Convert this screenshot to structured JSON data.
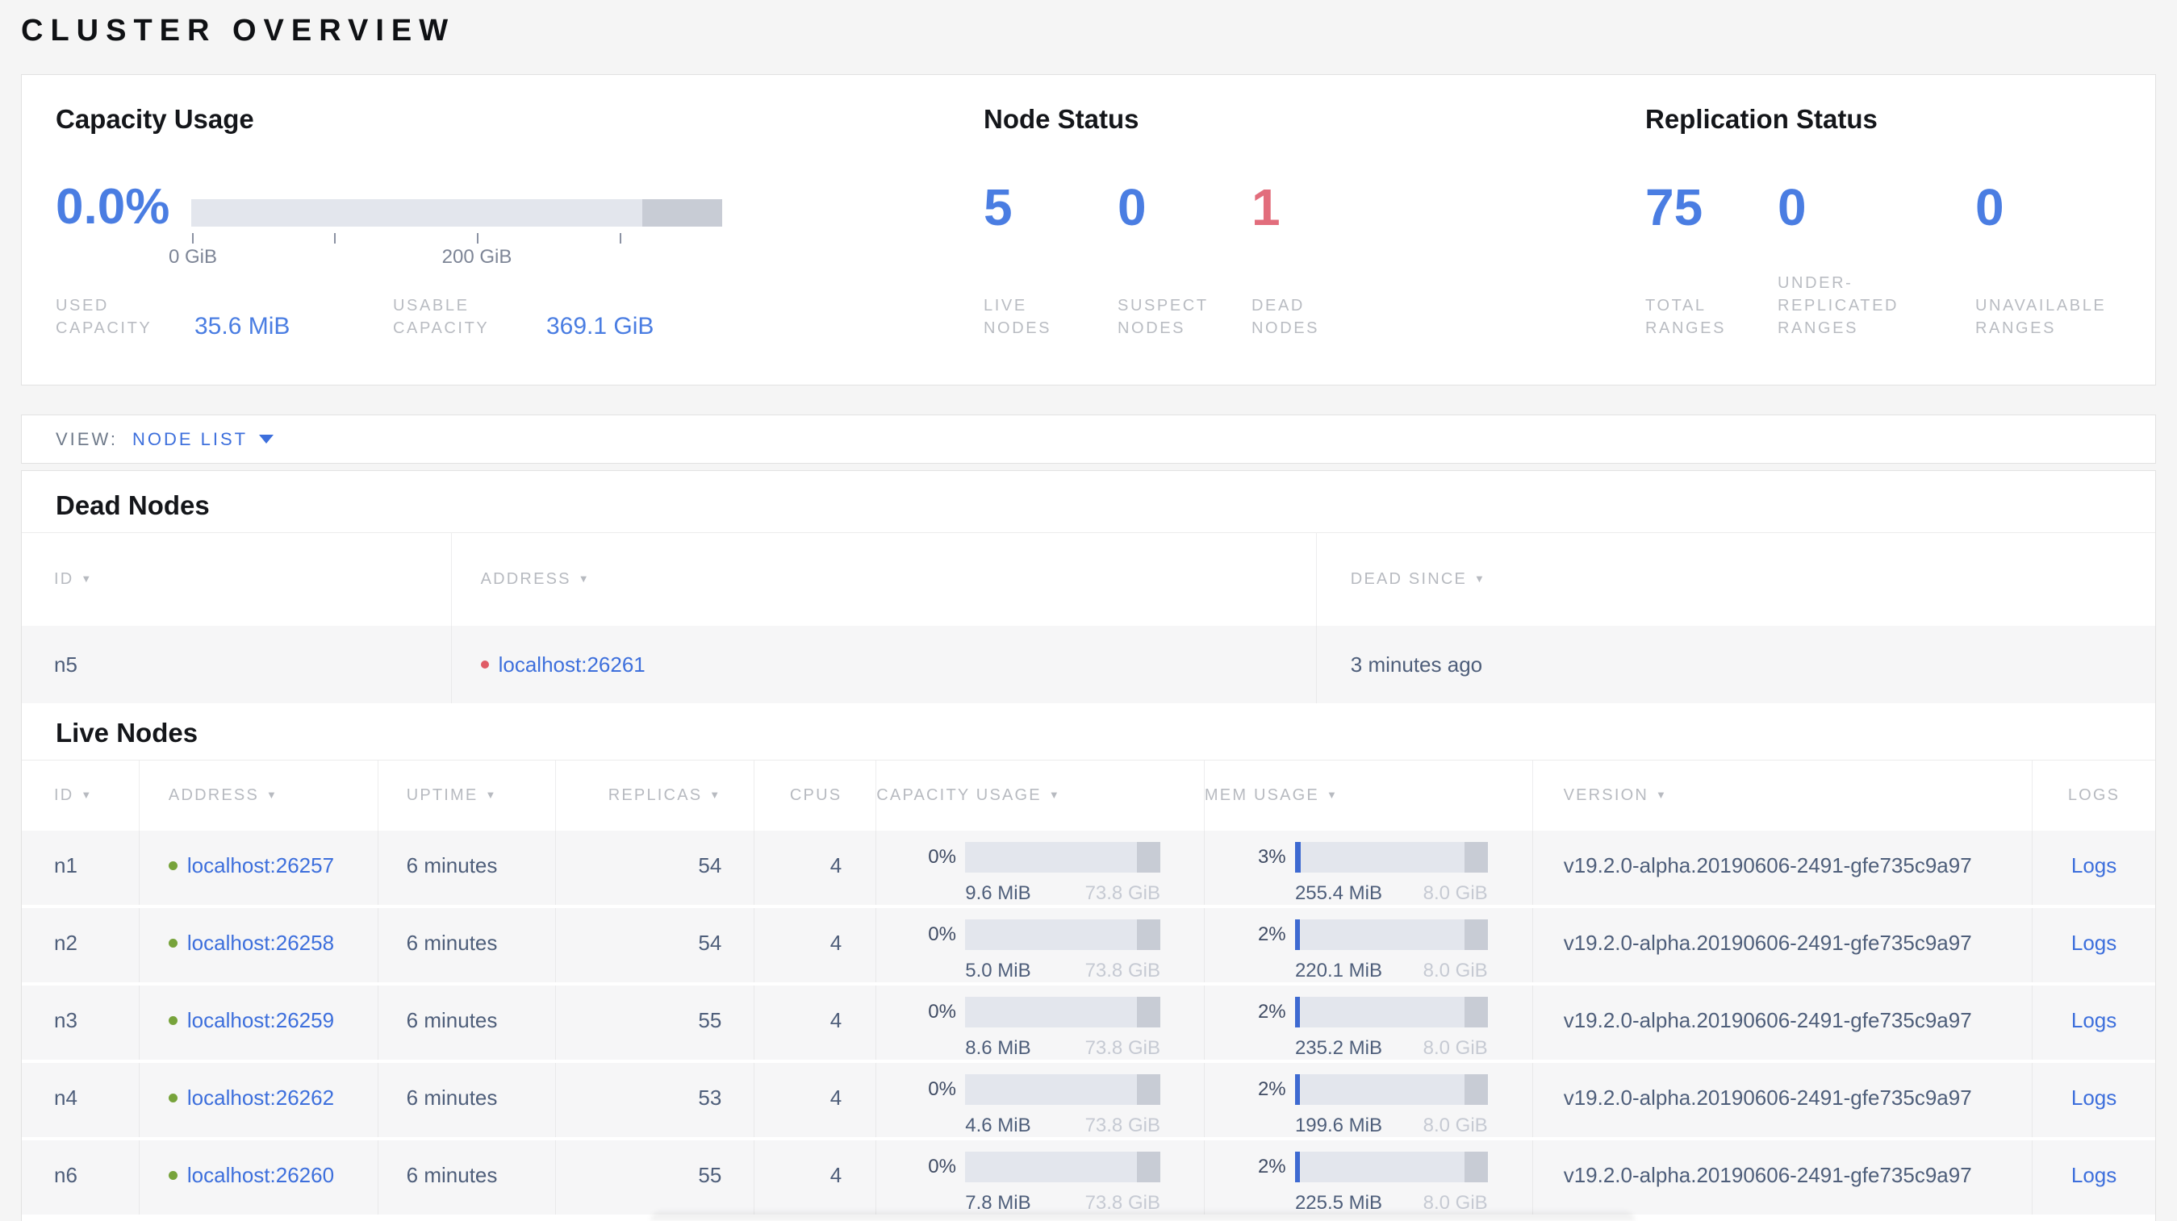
{
  "page": {
    "title": "CLUSTER OVERVIEW"
  },
  "colors": {
    "page_bg": "#f5f5f5",
    "card_border": "#e2e2e2",
    "accent_blue": "#4a7de2",
    "link_blue": "#3d6fdc",
    "dead_red": "#e26d7c",
    "dot_green": "#77a33b",
    "dot_red": "#e05c66",
    "label_gray": "#b9bcc2",
    "text_dark": "#16181d",
    "slate": "#4e5e7a",
    "bar_track": "#e3e6ed",
    "bar_dark": "#c8ccd5",
    "bar_blue": "#3e6ad1",
    "row_bg": "#f6f6f7"
  },
  "summary": {
    "capacity": {
      "title": "Capacity Usage",
      "percent": "0.0%",
      "tick_labels": [
        "0 GiB",
        "200 GiB"
      ],
      "stats": [
        {
          "label": "USED CAPACITY",
          "value": "35.6 MiB"
        },
        {
          "label": "USABLE CAPACITY",
          "value": "369.1 GiB"
        }
      ]
    },
    "node_status": {
      "title": "Node Status",
      "stats": [
        {
          "value": "5",
          "label": "LIVE NODES",
          "danger": false
        },
        {
          "value": "0",
          "label": "SUSPECT NODES",
          "danger": false
        },
        {
          "value": "1",
          "label": "DEAD NODES",
          "danger": true
        }
      ]
    },
    "replication": {
      "title": "Replication Status",
      "stats": [
        {
          "value": "75",
          "label": "TOTAL RANGES"
        },
        {
          "value": "0",
          "label": "UNDER-REPLICATED RANGES"
        },
        {
          "value": "0",
          "label": "UNAVAILABLE RANGES"
        }
      ]
    }
  },
  "view_bar": {
    "label": "VIEW:",
    "selected": "NODE LIST"
  },
  "dead_nodes": {
    "title": "Dead Nodes",
    "columns": [
      {
        "label": "ID",
        "sort_icon": true
      },
      {
        "label": "ADDRESS",
        "sort_icon": true
      },
      {
        "label": "DEAD SINCE",
        "sort_icon": true
      }
    ],
    "rows": [
      {
        "id": "n5",
        "address": "localhost:26261",
        "dead_since": "3 minutes ago"
      }
    ]
  },
  "live_nodes": {
    "title": "Live Nodes",
    "logs_label": "Logs",
    "columns": [
      {
        "label": "ID",
        "sort_icon": true
      },
      {
        "label": "ADDRESS",
        "sort_icon": true
      },
      {
        "label": "UPTIME",
        "sort_icon": true
      },
      {
        "label": "REPLICAS",
        "sort_icon": true
      },
      {
        "label": "CPUS",
        "sort_icon": false
      },
      {
        "label": "CAPACITY USAGE",
        "sort_icon": true
      },
      {
        "label": "MEM USAGE",
        "sort_icon": true
      },
      {
        "label": "VERSION",
        "sort_icon": true
      },
      {
        "label": "LOGS",
        "sort_icon": false
      }
    ],
    "rows": [
      {
        "id": "n1",
        "address": "localhost:26257",
        "uptime": "6 minutes",
        "replicas": "54",
        "cpus": "4",
        "capacity": {
          "percent": "0%",
          "fill_pct": 0,
          "used": "9.6 MiB",
          "total": "73.8 GiB"
        },
        "memory": {
          "percent": "3%",
          "fill_pct": 3,
          "used": "255.4 MiB",
          "total": "8.0 GiB"
        },
        "version": "v19.2.0-alpha.20190606-2491-gfe735c9a97"
      },
      {
        "id": "n2",
        "address": "localhost:26258",
        "uptime": "6 minutes",
        "replicas": "54",
        "cpus": "4",
        "capacity": {
          "percent": "0%",
          "fill_pct": 0,
          "used": "5.0 MiB",
          "total": "73.8 GiB"
        },
        "memory": {
          "percent": "2%",
          "fill_pct": 2.5,
          "used": "220.1 MiB",
          "total": "8.0 GiB"
        },
        "version": "v19.2.0-alpha.20190606-2491-gfe735c9a97"
      },
      {
        "id": "n3",
        "address": "localhost:26259",
        "uptime": "6 minutes",
        "replicas": "55",
        "cpus": "4",
        "capacity": {
          "percent": "0%",
          "fill_pct": 0,
          "used": "8.6 MiB",
          "total": "73.8 GiB"
        },
        "memory": {
          "percent": "2%",
          "fill_pct": 2.5,
          "used": "235.2 MiB",
          "total": "8.0 GiB"
        },
        "version": "v19.2.0-alpha.20190606-2491-gfe735c9a97"
      },
      {
        "id": "n4",
        "address": "localhost:26262",
        "uptime": "6 minutes",
        "replicas": "53",
        "cpus": "4",
        "capacity": {
          "percent": "0%",
          "fill_pct": 0,
          "used": "4.6 MiB",
          "total": "73.8 GiB"
        },
        "memory": {
          "percent": "2%",
          "fill_pct": 2.5,
          "used": "199.6 MiB",
          "total": "8.0 GiB"
        },
        "version": "v19.2.0-alpha.20190606-2491-gfe735c9a97"
      },
      {
        "id": "n6",
        "address": "localhost:26260",
        "uptime": "6 minutes",
        "replicas": "55",
        "cpus": "4",
        "capacity": {
          "percent": "0%",
          "fill_pct": 0,
          "used": "7.8 MiB",
          "total": "73.8 GiB"
        },
        "memory": {
          "percent": "2%",
          "fill_pct": 2.5,
          "used": "225.5 MiB",
          "total": "8.0 GiB"
        },
        "version": "v19.2.0-alpha.20190606-2491-gfe735c9a97"
      }
    ]
  }
}
